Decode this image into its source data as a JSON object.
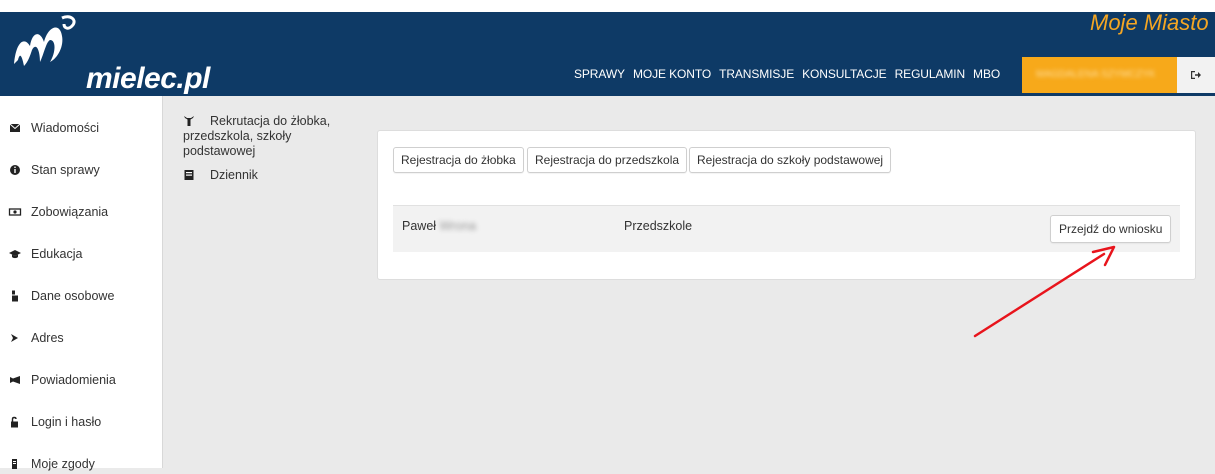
{
  "header": {
    "logo_text": "mielec.pl",
    "city_title": "Moje Miasto",
    "nav": [
      "SPRAWY",
      "MOJE KONTO",
      "TRANSMISJE",
      "KONSULTACJE",
      "REGULAMIN",
      "MBO"
    ],
    "user_name": "MAGDALENA SZYMCZYK"
  },
  "sidebar": {
    "items": [
      {
        "label": "Wiadomości",
        "icon": "envelope-icon"
      },
      {
        "label": "Stan sprawy",
        "icon": "info-icon"
      },
      {
        "label": "Zobowiązania",
        "icon": "money-icon"
      },
      {
        "label": "Edukacja",
        "icon": "graduation-cap-icon"
      },
      {
        "label": "Dane osobowe",
        "icon": "user-icon"
      },
      {
        "label": "Adres",
        "icon": "location-icon"
      },
      {
        "label": "Powiadomienia",
        "icon": "megaphone-icon"
      },
      {
        "label": "Login i hasło",
        "icon": "lock-icon"
      },
      {
        "label": "Moje zgody",
        "icon": "document-icon"
      }
    ]
  },
  "submenu": {
    "recruitment": "Rekrutacja do żłobka, przedszkola, szkoły podstawowej",
    "journal": "Dziennik"
  },
  "main": {
    "buttons": {
      "nursery": "Rejestracja do żłobka",
      "preschool": "Rejestracja do przedszkola",
      "school": "Rejestracja do szkoły podstawowej"
    },
    "row": {
      "first_name": "Paweł",
      "last_name": "Wrona",
      "type": "Przedszkole",
      "action": "Przejdź do wniosku"
    }
  },
  "colors": {
    "header_bg": "#0e3a66",
    "accent": "#f7a91a",
    "annotation_arrow": "#e8141c"
  }
}
